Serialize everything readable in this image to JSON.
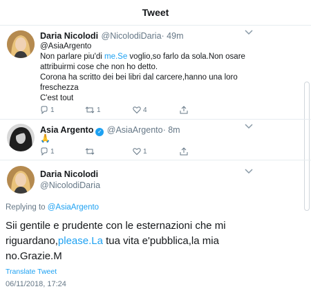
{
  "header": {
    "title": "Tweet"
  },
  "tweet1": {
    "name": "Daria Nicolodi",
    "handle": "@NicolodiDaria",
    "time": "· 49m",
    "reply_to": "@AsiaArgento",
    "line1_pre": "Non parlare piu'di ",
    "line1_link": "me.Se",
    "line1_post": " voglio,so farlo da sola.Non osare",
    "line2": "attribuirmi cose che non ho detto.",
    "line3": "Corona ha scritto dei bei libri dal carcere,hanno una loro",
    "line4": "freschezza",
    "line5": "C'est tout",
    "replies": "1",
    "retweets": "1",
    "likes": "4"
  },
  "tweet2": {
    "name": "Asia Argento",
    "handle": "@AsiaArgento",
    "time": "· 8m",
    "body": "🙏",
    "replies": "1",
    "retweets": "",
    "likes": "1"
  },
  "main": {
    "name": "Daria Nicolodi",
    "handle": "@NicolodiDaria",
    "replying_prefix": "Replying to ",
    "replying_handle": "@AsiaArgento",
    "line1": "Sii gentile e prudente con le esternazioni che mi",
    "line2_pre": "riguardano,",
    "line2_link": "please.La",
    "line2_post": " tua vita e'pubblica,la mia",
    "line3": "no.Grazie.M",
    "translate": "Translate Tweet",
    "timestamp": "06/11/2018, 17:24"
  },
  "icons": {
    "reply": "reply-icon",
    "retweet": "retweet-icon",
    "like": "heart-icon",
    "share": "share-icon",
    "more": "chevron-down-icon",
    "verified": "verified-badge-icon"
  },
  "colors": {
    "link": "#1da1f2",
    "secondary": "#657786",
    "divider": "#e6ecf0"
  }
}
